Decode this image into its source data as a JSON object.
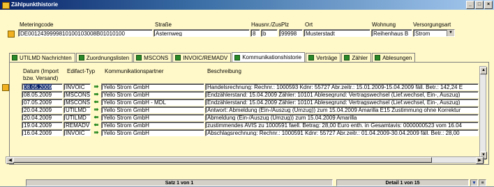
{
  "window": {
    "title": "Zählpunkthistorie",
    "buttons": [
      "_",
      "□",
      "×"
    ]
  },
  "header": {
    "labels": {
      "meteringcode": "Meteringcode",
      "strasse": "Straße",
      "hausnr": "Hausnr./Zus.",
      "plz": "Plz",
      "ort": "Ort",
      "wohnung": "Wohnung",
      "versorgungsart": "Versorgungsart"
    },
    "values": {
      "meteringcode": "DE0012439999810100103008B01010100",
      "strasse": "Asternweg",
      "hausnr": "8",
      "zusatz": "b",
      "plz": "99998",
      "ort": "Musterstadt",
      "wohnung": "Reihenhaus B",
      "versorgungsart": "Strom"
    }
  },
  "tabs": [
    {
      "label": "UTILMD Nachrichten",
      "active": false
    },
    {
      "label": "Zuordnungslisten",
      "active": false
    },
    {
      "label": "MSCONS",
      "active": false
    },
    {
      "label": "INVOIC/REMADV",
      "active": false
    },
    {
      "label": "Kommunikationshistorie",
      "active": true
    },
    {
      "label": "Verträge",
      "active": false
    },
    {
      "label": "Zähler",
      "active": false
    },
    {
      "label": "Ablesungen",
      "active": false
    }
  ],
  "table": {
    "headers": {
      "datum": "Datum (Import bzw. Versand)",
      "edifact": "Edifact-Typ",
      "partner": "Kommunikationspartner",
      "beschreibung": "Beschreibung"
    },
    "rows": [
      {
        "datum": "08.05.2009",
        "typ": "INVOIC",
        "dir": "out",
        "partner": "Yello Strom GmbH",
        "beschreibung": "Handelsrechnung: Rechnr.: 1000593 Kdnr: 55727 Abr.zeitr.: 15.01.2009-15.04.2009 fäll. Betr.: 142,24 E"
      },
      {
        "datum": "08.05.2009",
        "typ": "MSCONS",
        "dir": "out",
        "partner": "Yello Strom GmbH",
        "beschreibung": "Endzählerstand: 15.04.2009 Zähler: 10101 Ablesegrund: Vertragswechsel (Lief.wechsel, Ein-, Auszug)"
      },
      {
        "datum": "07.05.2009",
        "typ": "MSCONS",
        "dir": "in",
        "partner": "Yello Strom GmbH - MDL",
        "beschreibung": "Endzählerstand: 15.04.2009 Zähler: 10101 Ablesegrund: Vertragswechsel (Lief.wechsel, Ein-, Auszug)"
      },
      {
        "datum": "20.04.2009",
        "typ": "UTILMD",
        "dir": "out",
        "partner": "Yello Strom GmbH",
        "beschreibung": "Antwort: Abmeldung (Ein-/Auszug (Umzug)) zum 15.04.2009 Amarilla E15 Zustimmung ohne Korrektur"
      },
      {
        "datum": "20.04.2009",
        "typ": "UTILMD",
        "dir": "in",
        "partner": "Yello Strom GmbH",
        "beschreibung": "Abmeldung (Ein-/Auszug (Umzug)) zum 15.04.2009 Amarilla"
      },
      {
        "datum": "19.04.2009",
        "typ": "REMADV",
        "dir": "in",
        "partner": "Yello Strom GmbH",
        "beschreibung": "zustimmendes AVIS zu 1000591 faell. Betrag: 28,00 Euro enth. in Gesamtavis: 0000000523 vom 16.04"
      },
      {
        "datum": "16.04.2009",
        "typ": "INVOIC",
        "dir": "out",
        "partner": "Yello Strom GmbH",
        "beschreibung": "Abschlagsrechnung: Rechnr.: 1000591 Kdnr: 55727 Abr.zeitr.: 01.04.2009-30.04.2009 fäll. Betr.: 28,00"
      }
    ]
  },
  "status": {
    "left": "Satz 1 von 1",
    "right": "Detail 1 von 15"
  }
}
